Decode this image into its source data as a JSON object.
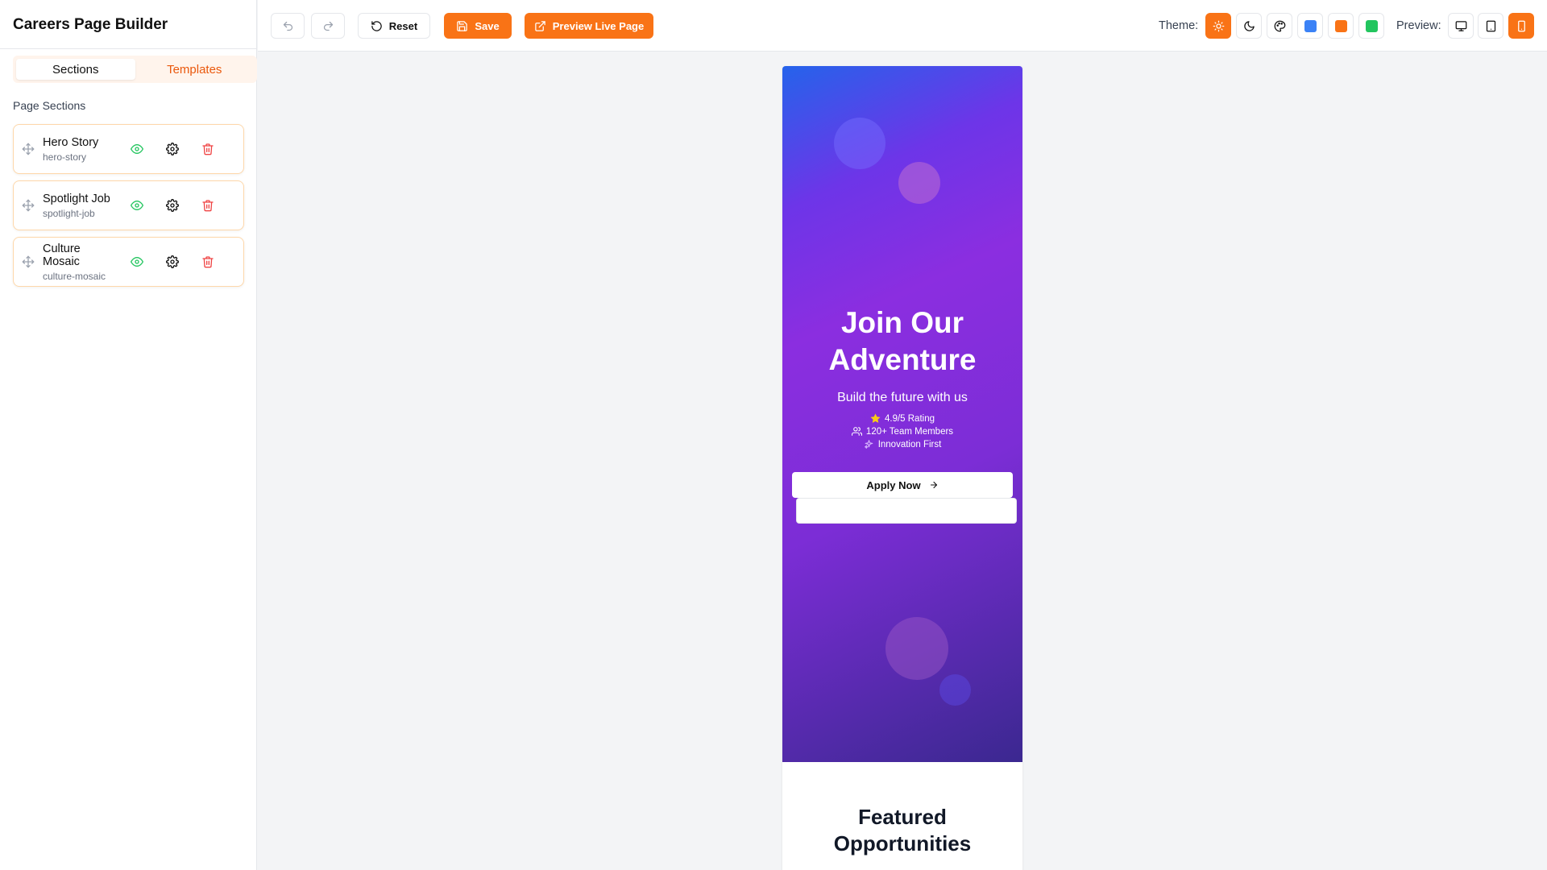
{
  "sidebar": {
    "title": "Careers Page Builder",
    "tabs": [
      {
        "label": "Sections",
        "active": true
      },
      {
        "label": "Templates",
        "active": false
      }
    ],
    "heading": "Page Sections",
    "sections": [
      {
        "title": "Hero Story",
        "id": "hero-story"
      },
      {
        "title": "Spotlight Job",
        "id": "spotlight-job"
      },
      {
        "title": "Culture Mosaic",
        "id": "culture-mosaic"
      }
    ],
    "icons": [
      "move-icon",
      "eye-icon",
      "gear-icon",
      "trash-icon"
    ]
  },
  "toolbar": {
    "undo_icon": "undo-icon",
    "redo_icon": "redo-icon",
    "reset_label": "Reset",
    "save_label": "Save",
    "preview_label": "Preview Live Page",
    "theme_label": "Theme:",
    "themes": [
      {
        "name": "sun-icon",
        "active": true
      },
      {
        "name": "moon-icon",
        "active": false
      },
      {
        "name": "palette-icon",
        "active": false
      }
    ],
    "theme_swatches": [
      "#3b82f6",
      "#f97316",
      "#22c55e"
    ],
    "preview_label_short": "Preview:",
    "devices": [
      {
        "name": "desktop-icon",
        "active": false
      },
      {
        "name": "tablet-icon",
        "active": false
      },
      {
        "name": "mobile-icon",
        "active": true
      }
    ]
  },
  "preview": {
    "hero_title_line1": "Join Our",
    "hero_title_line2": "Adventure",
    "hero_subtitle": "Build the future with us",
    "stats": [
      {
        "icon": "star-icon",
        "text": "4.9/5 Rating"
      },
      {
        "icon": "users-icon",
        "text": "120+ Team Members"
      },
      {
        "icon": "sparkles-icon",
        "text": "Innovation First"
      }
    ],
    "apply_label": "Apply Now",
    "featured_line1": "Featured",
    "featured_line2": "Opportunities"
  },
  "colors": {
    "accent": "#f97316",
    "gradient_start": "#2563eb",
    "gradient_mid": "#8b2ee0",
    "gradient_end": "#3b2890",
    "star": "#facc15"
  }
}
